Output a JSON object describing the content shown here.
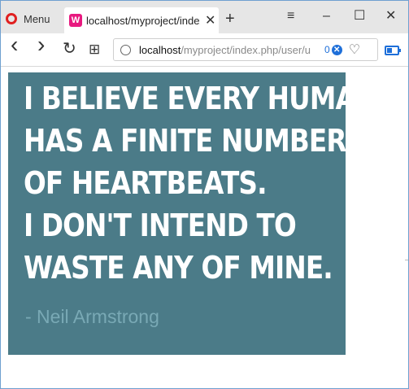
{
  "browser": {
    "menu_label": "Menu",
    "tab": {
      "favicon_text": "W",
      "title": "localhost/myproject/index"
    },
    "new_tab_symbol": "+",
    "window_controls": {
      "menu_symbol": "≡",
      "minimize_symbol": "–",
      "maximize_symbol": "☐",
      "close_symbol": "✕"
    },
    "toolbar": {
      "back_symbol": "‹",
      "forward_symbol": "›",
      "reload_symbol": "↻",
      "speed_dial_symbol": "⊞",
      "url_host": "localhost",
      "url_path": "/myproject/index.php/user/u",
      "adblock_count": "0",
      "heart_symbol": "♡"
    }
  },
  "content": {
    "quote_lines": [
      "I believe every human",
      "has a finite number",
      "of heartbeats.",
      "I don't intend to",
      "waste any of mine."
    ],
    "author": "- Neil Armstrong"
  },
  "colors": {
    "quote_background": "#4b7b88",
    "author_text": "#79a9b5",
    "accent": "#1e6fd9",
    "favicon": "#e8197f"
  }
}
